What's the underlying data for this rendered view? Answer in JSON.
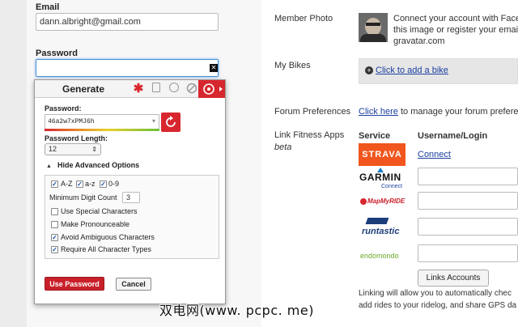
{
  "form": {
    "email_label": "Email",
    "email_value": "dann.albright@gmail.com",
    "password_label": "Password"
  },
  "generator": {
    "title": "Generate",
    "password_label": "Password:",
    "password_value": "46a2w7xPMJ6h",
    "length_label": "Password Length:",
    "length_value": "12",
    "advanced_toggle": "Hide Advanced Options",
    "options": {
      "az_upper": "A-Z",
      "az_lower": "a-z",
      "digits": "0-9",
      "min_digit_label": "Minimum Digit Count",
      "min_digit_value": "3",
      "special": "Use Special Characters",
      "pronounceable": "Make Pronounceable",
      "avoid_ambiguous": "Avoid Ambiguous Characters",
      "require_all": "Require All Character Types"
    },
    "use_button": "Use Password",
    "cancel_button": "Cancel",
    "accent_color": "#d8262e"
  },
  "profile": {
    "member_photo_label": "Member Photo",
    "photo_text_1": "Connect your account with Faceb",
    "photo_text_2": "this image or register your email a",
    "photo_text_3": "gravatar.com",
    "my_bikes_label": "My Bikes",
    "add_bike_link": "Click to add a bike",
    "forum_label": "Forum Preferences",
    "forum_link": "Click here",
    "forum_text": " to manage your forum preferenc",
    "fitness_label": "Link Fitness Apps",
    "fitness_sub": "beta",
    "col_service": "Service",
    "col_username": "Username/Login",
    "strava_connect": "Connect",
    "link_accounts_button": "Links Accounts",
    "footer_1": "Linking will allow you to automatically chec",
    "footer_2": "add rides to your ridelog, and share GPS da"
  },
  "services": {
    "strava": "STRAVA",
    "garmin": "GARMIN",
    "garmin_sub": "Connect",
    "mapmyride": "MapMyRIDE",
    "runtastic": "runtastic",
    "endomondo": "endomondo"
  },
  "watermark": "双电网(www. pcpc. me)"
}
